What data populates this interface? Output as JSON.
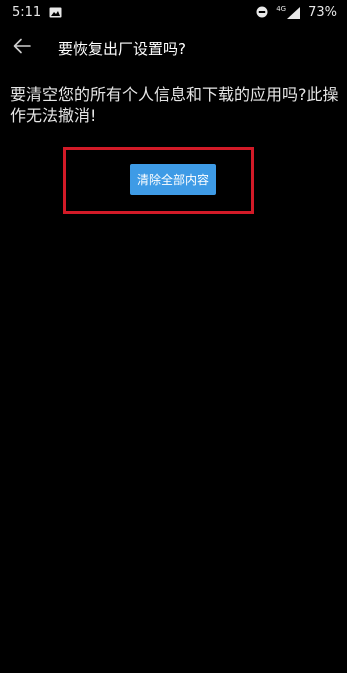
{
  "status_bar": {
    "time": "5:11",
    "network": "4G",
    "battery": "73%"
  },
  "app_bar": {
    "title": "要恢复出厂设置吗?"
  },
  "content": {
    "warning": "要清空您的所有个人信息和下载的应用吗?此操作无法撤消!",
    "erase_button_label": "清除全部内容"
  },
  "colors": {
    "background": "#000000",
    "button": "#3e9be6",
    "highlight": "#d21a27"
  }
}
